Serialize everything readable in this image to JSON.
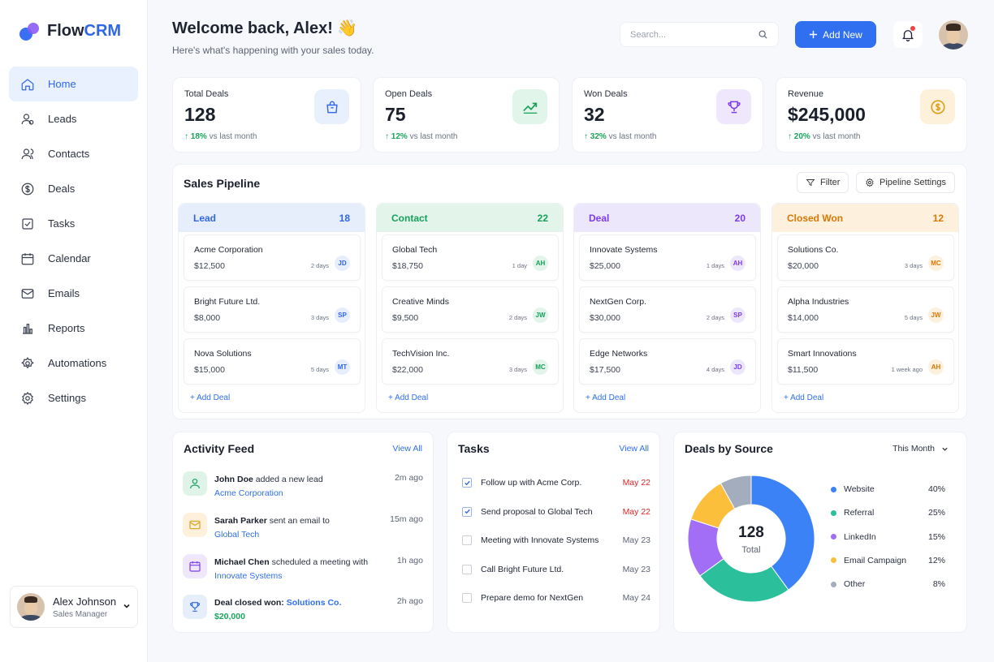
{
  "app": {
    "name_a": "Flow",
    "name_b": "CRM"
  },
  "sidebar": {
    "items": [
      {
        "label": "Home"
      },
      {
        "label": "Leads"
      },
      {
        "label": "Contacts"
      },
      {
        "label": "Deals"
      },
      {
        "label": "Tasks"
      },
      {
        "label": "Calendar"
      },
      {
        "label": "Emails"
      },
      {
        "label": "Reports"
      },
      {
        "label": "Automations"
      },
      {
        "label": "Settings"
      }
    ],
    "user": {
      "name": "Alex Johnson",
      "role": "Sales Manager"
    }
  },
  "header": {
    "title": "Welcome back, Alex! 👋",
    "subtitle": "Here's what's happening with your sales today.",
    "search_placeholder": "Search...",
    "add_label": "Add New"
  },
  "stats": [
    {
      "label": "Total Deals",
      "value": "128",
      "change": "18%",
      "suffix": "vs last month",
      "icon": "bag-icon"
    },
    {
      "label": "Open Deals",
      "value": "75",
      "change": "12%",
      "suffix": "vs last month",
      "icon": "trend-icon"
    },
    {
      "label": "Won Deals",
      "value": "32",
      "change": "32%",
      "suffix": "vs last month",
      "icon": "trophy-icon"
    },
    {
      "label": "Revenue",
      "value": "$245,000",
      "change": "20%",
      "suffix": "vs last month",
      "icon": "dollar-icon"
    }
  ],
  "pipeline": {
    "title": "Sales Pipeline",
    "filter_label": "Filter",
    "settings_label": "Pipeline Settings",
    "add_deal_label": "Add Deal",
    "columns": [
      {
        "name": "Lead",
        "count": "18",
        "color": "#2f66e8",
        "bg": "#e6eefc",
        "deals": [
          {
            "name": "Acme Corporation",
            "amount": "$12,500",
            "age": "2 days",
            "initials": "JD"
          },
          {
            "name": "Bright Future Ltd.",
            "amount": "$8,000",
            "age": "3 days",
            "initials": "SP"
          },
          {
            "name": "Nova Solutions",
            "amount": "$15,000",
            "age": "5 days",
            "initials": "MT"
          }
        ]
      },
      {
        "name": "Contact",
        "count": "22",
        "color": "#16a05a",
        "bg": "#e3f4ea",
        "deals": [
          {
            "name": "Global Tech",
            "amount": "$18,750",
            "age": "1 day",
            "initials": "AH"
          },
          {
            "name": "Creative Minds",
            "amount": "$9,500",
            "age": "2 days",
            "initials": "JW"
          },
          {
            "name": "TechVision Inc.",
            "amount": "$22,000",
            "age": "3 days",
            "initials": "MC"
          }
        ]
      },
      {
        "name": "Deal",
        "count": "20",
        "color": "#7c3aed",
        "bg": "#ede7fb",
        "deals": [
          {
            "name": "Innovate Systems",
            "amount": "$25,000",
            "age": "1 days",
            "initials": "AH"
          },
          {
            "name": "NextGen Corp.",
            "amount": "$30,000",
            "age": "2 days",
            "initials": "SP"
          },
          {
            "name": "Edge Networks",
            "amount": "$17,500",
            "age": "4 days",
            "initials": "JD"
          }
        ]
      },
      {
        "name": "Closed Won",
        "count": "12",
        "color": "#d97706",
        "bg": "#fdf0dc",
        "deals": [
          {
            "name": "Solutions Co.",
            "amount": "$20,000",
            "age": "3 days",
            "initials": "MC"
          },
          {
            "name": "Alpha Industries",
            "amount": "$14,000",
            "age": "5 days",
            "initials": "JW"
          },
          {
            "name": "Smart Innovations",
            "amount": "$11,500",
            "age": "1 week ago",
            "initials": "AH"
          }
        ]
      }
    ]
  },
  "activity": {
    "title": "Activity Feed",
    "view_all": "View All",
    "items": [
      {
        "who": "John Doe",
        "action": " added a new lead",
        "link": "Acme Corporation",
        "time": "2m ago"
      },
      {
        "who": "Sarah Parker",
        "action": " sent an email to",
        "link": "Global Tech",
        "time": "15m ago"
      },
      {
        "who": "Michael Chen",
        "action": " scheduled a meeting with",
        "link": "Innovate Systems",
        "time": "1h ago"
      },
      {
        "who": "Deal closed won:",
        "action": " ",
        "link": "Solutions Co.",
        "amount": "$20,000",
        "time": "2h ago"
      }
    ]
  },
  "tasks": {
    "title": "Tasks",
    "view_all": "View All",
    "items": [
      {
        "label": "Follow up with Acme Corp.",
        "date": "May 22",
        "done": true
      },
      {
        "label": "Send proposal to Global Tech",
        "date": "May 22",
        "done": true
      },
      {
        "label": "Meeting with Innovate Systems",
        "date": "May 23",
        "done": false
      },
      {
        "label": "Call Bright Future Ltd.",
        "date": "May 23",
        "done": false
      },
      {
        "label": "Prepare demo for NextGen",
        "date": "May 24",
        "done": false
      }
    ]
  },
  "chart_data": {
    "type": "pie",
    "title": "Deals by Source",
    "period": "This Month",
    "center_value": "128",
    "center_label": "Total",
    "categories": [
      "Website",
      "Referral",
      "LinkedIn",
      "Email Campaign",
      "Other"
    ],
    "values": [
      40,
      25,
      15,
      12,
      8
    ],
    "labels": [
      "40%",
      "25%",
      "15%",
      "12%",
      "8%"
    ],
    "colors": [
      "#3b82f6",
      "#2bbf9b",
      "#a16ef5",
      "#fbbf3c",
      "#a4adbd"
    ],
    "legend": "right"
  }
}
